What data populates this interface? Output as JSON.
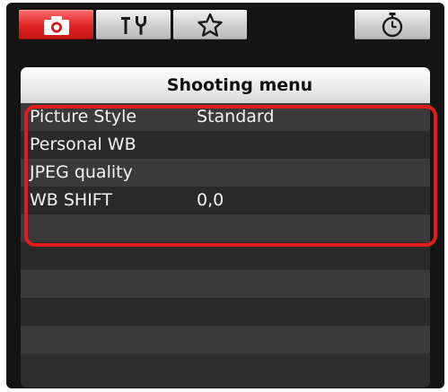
{
  "tabs": {
    "shooting": {
      "icon": "camera-icon",
      "active": true
    },
    "setup": {
      "icon": "wrench-icon",
      "active": false
    },
    "my_menu": {
      "icon": "star-icon",
      "active": false
    },
    "timer": {
      "icon": "stopwatch-icon",
      "active": false
    }
  },
  "menu": {
    "title": "Shooting menu",
    "items": [
      {
        "label": "Picture Style",
        "value": "Standard"
      },
      {
        "label": "Personal WB",
        "value": ""
      },
      {
        "label": "JPEG quality",
        "value": ""
      },
      {
        "label": "WB SHIFT",
        "value": "0,0"
      }
    ]
  },
  "colors": {
    "active_tab": "#e02222",
    "highlight_border": "#e31b1b",
    "panel_background": "#141414"
  }
}
